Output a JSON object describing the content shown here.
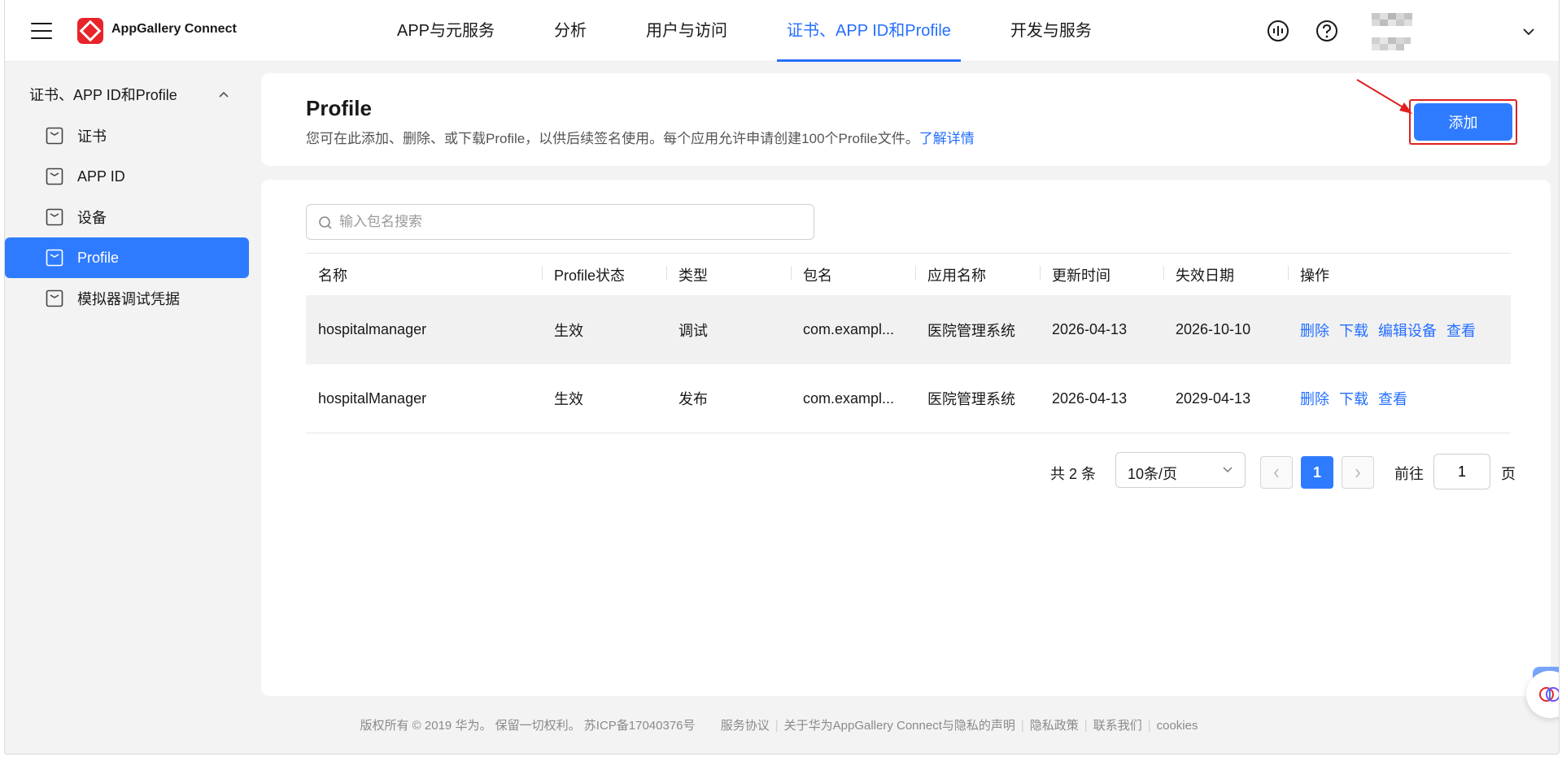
{
  "header": {
    "brand": "AppGallery Connect",
    "nav": [
      {
        "label": "APP与元服务"
      },
      {
        "label": "分析"
      },
      {
        "label": "用户与访问"
      },
      {
        "label": "证书、APP ID和Profile"
      },
      {
        "label": "开发与服务"
      }
    ],
    "active_nav": "证书、APP ID和Profile"
  },
  "sidebar": {
    "group_label": "证书、APP ID和Profile",
    "items": [
      {
        "label": "证书"
      },
      {
        "label": "APP ID"
      },
      {
        "label": "设备"
      },
      {
        "label": "Profile"
      },
      {
        "label": "模拟器调试凭据"
      }
    ],
    "active_item": "Profile"
  },
  "page": {
    "title": "Profile",
    "description": "您可在此添加、删除、或下载Profile，以供后续签名使用。每个应用允许申请创建100个Profile文件。",
    "learn_more": "了解详情",
    "add_label": "添加"
  },
  "search": {
    "placeholder": "输入包名搜索",
    "value": ""
  },
  "table": {
    "columns": [
      "名称",
      "Profile状态",
      "类型",
      "包名",
      "应用名称",
      "更新时间",
      "失效日期",
      "操作"
    ],
    "rows": [
      {
        "name": "hospitalmanager",
        "status": "生效",
        "type": "调试",
        "package": "com.exampl...",
        "app_name": "医院管理系统",
        "updated": "2026-04-13",
        "expires": "2026-10-10",
        "actions": [
          "删除",
          "下载",
          "编辑设备",
          "查看"
        ]
      },
      {
        "name": "hospitalManager",
        "status": "生效",
        "type": "发布",
        "package": "com.exampl...",
        "app_name": "医院管理系统",
        "updated": "2026-04-13",
        "expires": "2029-04-13",
        "actions": [
          "删除",
          "下载",
          "查看"
        ]
      }
    ]
  },
  "pagination": {
    "total": "共 2 条",
    "page_size": "10条/页",
    "current_page": "1",
    "goto_label": "前往",
    "goto_value": "1",
    "page_unit": "页"
  },
  "footer": {
    "copyright": "版权所有 © 2019 华为。 保留一切权利。 苏ICP备17040376号",
    "links": [
      "服务协议",
      "关于华为AppGallery Connect与隐私的声明",
      "隐私政策",
      "联系我们",
      "cookies"
    ]
  },
  "colors": {
    "accent": "#2f7bff",
    "link": "#256fff",
    "highlight_border": "#e02020"
  }
}
